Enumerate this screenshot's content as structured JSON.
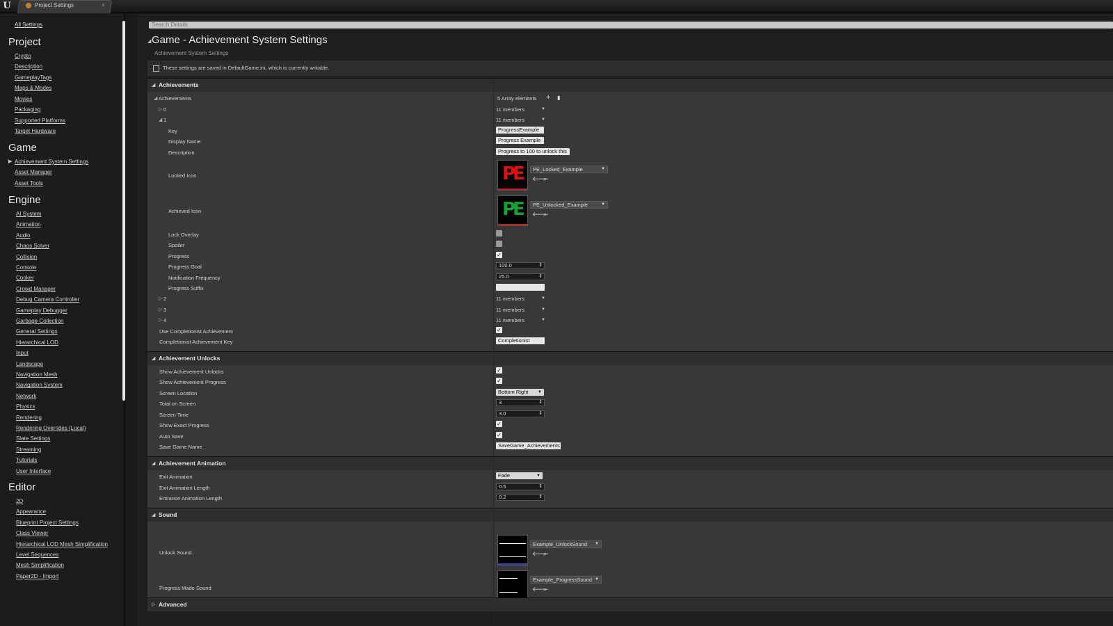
{
  "window": {
    "tab_label": "Project Settings",
    "close": "×"
  },
  "sidebar": {
    "all_settings": "All Settings",
    "sections": [
      {
        "title": "Project",
        "items": [
          "Crypto",
          "Description",
          "GameplayTags",
          "Maps & Modes",
          "Movies",
          "Packaging",
          "Supported Platforms",
          "Target Hardware"
        ]
      },
      {
        "title": "Game",
        "items": [
          "Achievement System Settings",
          "Asset Manager",
          "Asset Tools"
        ]
      },
      {
        "title": "Engine",
        "items": [
          "AI System",
          "Animation",
          "Audio",
          "Chaos Solver",
          "Collision",
          "Console",
          "Cooker",
          "Crowd Manager",
          "Debug Camera Controller",
          "Gameplay Debugger",
          "Garbage Collection",
          "General Settings",
          "Hierarchical LOD",
          "Input",
          "Landscape",
          "Navigation Mesh",
          "Navigation System",
          "Network",
          "Physics",
          "Rendering",
          "Rendering Overrides (Local)",
          "Slate Settings",
          "Streaming",
          "Tutorials",
          "User Interface"
        ]
      },
      {
        "title": "Editor",
        "items": [
          "2D",
          "Appearance",
          "Blueprint Project Settings",
          "Class Viewer",
          "Hierarchical LOD Mesh Simplification",
          "Level Sequences",
          "Mesh Simplification",
          "Paper2D - Import"
        ]
      }
    ]
  },
  "search": {
    "placeholder": "Search Details"
  },
  "page": {
    "title": "Game - Achievement System Settings",
    "subtitle": "Achievement System Settings",
    "notice": "These settings are saved in DefaultGame.ini, which is currently writable."
  },
  "achievements": {
    "section": "Achievements",
    "array_label": "Achievements",
    "array_count": "5 Array elements",
    "elements": [
      {
        "index": "0",
        "members": "11 members"
      },
      {
        "index": "1",
        "members": "11 members"
      },
      {
        "index": "2",
        "members": "11 members"
      },
      {
        "index": "3",
        "members": "11 members"
      },
      {
        "index": "4",
        "members": "11 members"
      }
    ],
    "item1": {
      "key_label": "Key",
      "key": "ProgressExample",
      "display_label": "Display Name",
      "display": "Progress Example",
      "desc_label": "Description",
      "desc": "Progress to 100 to unlock this",
      "locked_label": "Locked Icon",
      "locked_asset": "PE_Locked_Example",
      "achieved_label": "Achieved Icon",
      "achieved_asset": "PE_Unlocked_Example",
      "icon_text": "PE",
      "lock_overlay_label": "Lock Overlay",
      "spoiler_label": "Spoiler",
      "progress_label": "Progress",
      "goal_label": "Progress Goal",
      "goal": "100.0",
      "freq_label": "Notification Frequency",
      "freq": "25.0",
      "suffix_label": "Progress Suffix"
    },
    "use_completionist_label": "Use Completionist Achievement",
    "completionist_key_label": "Completionist Achievement Key",
    "completionist_key": "Completionist"
  },
  "unlocks": {
    "section": "Achievement Unlocks",
    "show_unlocks": "Show Achievement Unlocks",
    "show_progress": "Show Achievement Progress",
    "screen_location": "Screen Location",
    "screen_location_val": "Bottom Right",
    "total": "Total on Screen",
    "total_val": "3",
    "time": "Screen Time",
    "time_val": "3.0",
    "exact": "Show Exact Progress",
    "auto_save": "Auto Save",
    "save_name": "Save Game Name",
    "save_name_val": "SaveGame_Achievements"
  },
  "animation": {
    "section": "Achievement Animation",
    "exit": "Exit Animation",
    "exit_val": "Fade",
    "exit_len": "Exit Animation Length",
    "exit_len_val": "0.5",
    "entrance_len": "Entrance Animation Length",
    "entrance_len_val": "0.2"
  },
  "sound": {
    "section": "Sound",
    "unlock": "Unlock Sound",
    "unlock_asset": "Example_UnlockSound",
    "progress": "Progress Made Sound",
    "progress_asset": "Example_ProgressSound"
  },
  "advanced": {
    "section": "Advanced"
  },
  "colors": {
    "locked_icon": "#e01010",
    "achieved_icon": "#18a030",
    "accent": "#4040c0"
  }
}
